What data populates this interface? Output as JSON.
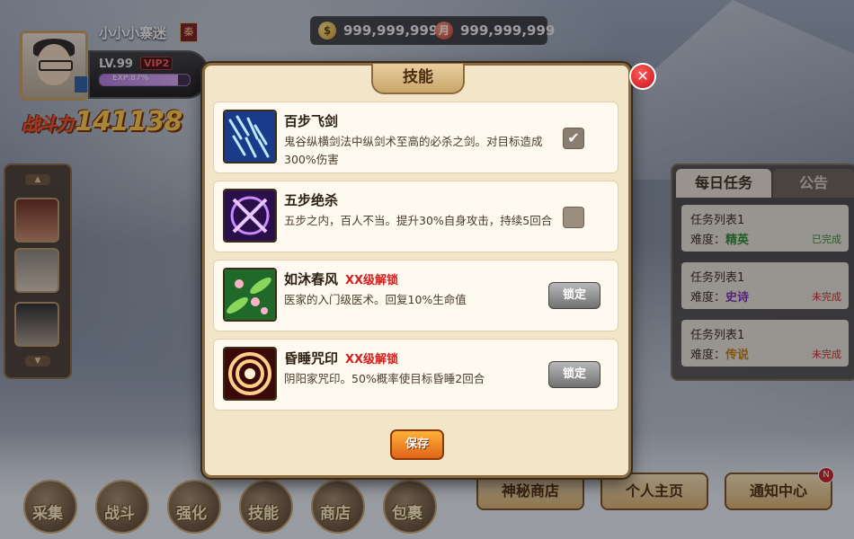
{
  "player": {
    "name": "小小小寨迷",
    "nation": "秦",
    "level": "LV.99",
    "vip": "VIP2",
    "exp": "EXP:87%",
    "exp_fraction": 0.87,
    "power_label": "战斗力",
    "power": "141138"
  },
  "currency": {
    "gold_icon": "$",
    "gold": "999,999,999",
    "ticket_icon": "月",
    "ticket": "999,999,999"
  },
  "dialog": {
    "title": "技能",
    "close_icon": "close-icon",
    "save_label": "保存",
    "skills": [
      {
        "name": "百步飞剑",
        "lock_text": "",
        "desc": "鬼谷纵横剑法中纵剑术至高的必杀之剑。对目标造成300%伤害",
        "checked": true,
        "check_mark": "✔",
        "icon": "sword-volley-icon"
      },
      {
        "name": "五步绝杀",
        "lock_text": "",
        "desc": "五步之内，百人不当。提升30%自身攻击，持续5回合",
        "checked": false,
        "check_mark": "",
        "icon": "kill-rune-icon"
      },
      {
        "name": "如沐春风",
        "lock_text": "XX级解锁",
        "desc": "医家的入门级医术。回复10%生命值",
        "button": "锁定",
        "icon": "blossom-leaf-icon"
      },
      {
        "name": "昏睡咒印",
        "lock_text": "XX级解锁",
        "desc": "阴阳家咒印。50%概率使目标昏睡2回合",
        "button": "锁定",
        "icon": "swirl-seal-icon"
      }
    ]
  },
  "tasks": {
    "tab_daily": "每日任务",
    "tab_notice": "公告",
    "difficulty_label": "难度：",
    "items": [
      {
        "title": "任务列表1",
        "difficulty": "精英",
        "difficulty_color": "#2a8a2a",
        "status": "已完成",
        "status_color": "#2a8a2a"
      },
      {
        "title": "任务列表1",
        "difficulty": "史诗",
        "difficulty_color": "#7a2ab0",
        "status": "未完成",
        "status_color": "#c82020"
      },
      {
        "title": "任务列表1",
        "difficulty": "传说",
        "difficulty_color": "#c87a10",
        "status": "未完成",
        "status_color": "#c82020"
      }
    ]
  },
  "bottom_nav": [
    {
      "label": "采集",
      "icon": "gather-bag-icon"
    },
    {
      "label": "战斗",
      "icon": "crossed-axes-icon"
    },
    {
      "label": "强化",
      "icon": "hammer-icon"
    },
    {
      "label": "技能",
      "icon": "skill-scroll-icon"
    },
    {
      "label": "商店",
      "icon": "shop-icon"
    },
    {
      "label": "包裹",
      "icon": "package-icon"
    }
  ],
  "right_buttons": {
    "shop": "神秘商店",
    "home": "个人主页",
    "notify": "通知中心",
    "notify_badge": "N"
  }
}
